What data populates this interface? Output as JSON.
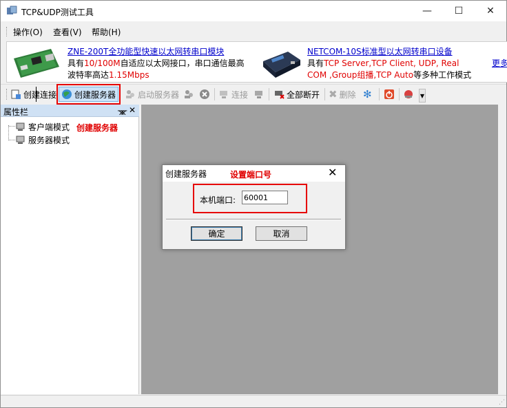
{
  "window": {
    "title": "TCP&UDP测试工具",
    "min": "—",
    "max": "☐",
    "close": "✕"
  },
  "menu": [
    "操作(O)",
    "查看(V)",
    "帮助(H)"
  ],
  "banner": {
    "ad1": {
      "link": "ZNE-200T全功能型快速以太网转串口模块",
      "l2_a": "具有",
      "l2_b": "10/100M",
      "l2_c": "自适应以太网接口，串口通信最高",
      "l3_a": "波特率高达",
      "l3_b": "1.15Mbps"
    },
    "ad2": {
      "link": "NETCOM-10S标准型以太网转串口设备",
      "l2_a": "具有",
      "l2_b": "TCP Server,TCP Client, UDP, Real",
      "l3_a": "COM ,Group组播,TCP Auto",
      "l3_b": "等多种工作模式"
    },
    "more": "更多"
  },
  "toolbar": {
    "create_conn": "创建连接",
    "create_server": "创建服务器",
    "start_server": "启动服务器",
    "connect": "连接",
    "disconnect_all": "全部断开",
    "delete": "删除"
  },
  "panel": {
    "title": "属性栏",
    "pin": "ᚘ",
    "close": "✕",
    "items": [
      "客户端模式",
      "服务器模式"
    ]
  },
  "annotations": {
    "create_server": "创建服务器",
    "set_port": "设置端口号"
  },
  "dialog": {
    "title": "创建服务器",
    "close": "✕",
    "port_label": "本机端口:",
    "port_value": "60001",
    "ok": "确定",
    "cancel": "取消"
  },
  "colors": {
    "annotation": "#e60000",
    "link": "#0000cc",
    "workspace": "#a0a0a0"
  }
}
